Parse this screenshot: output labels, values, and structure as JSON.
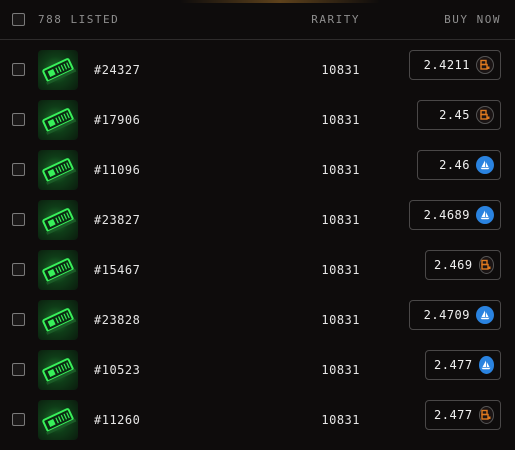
{
  "header": {
    "listed_label": "788 LISTED",
    "rarity_label": "RARITY",
    "buy_label": "BUY NOW"
  },
  "rows": [
    {
      "token": "#24327",
      "rarity": "10831",
      "price": "2.4211",
      "marketplace": "orange-b-icon"
    },
    {
      "token": "#17906",
      "rarity": "10831",
      "price": "2.45",
      "marketplace": "orange-b-icon"
    },
    {
      "token": "#11096",
      "rarity": "10831",
      "price": "2.46",
      "marketplace": "blue-sailboat-icon"
    },
    {
      "token": "#23827",
      "rarity": "10831",
      "price": "2.4689",
      "marketplace": "blue-sailboat-icon"
    },
    {
      "token": "#15467",
      "rarity": "10831",
      "price": "2.469",
      "marketplace": "orange-b-icon"
    },
    {
      "token": "#23828",
      "rarity": "10831",
      "price": "2.4709",
      "marketplace": "blue-sailboat-icon"
    },
    {
      "token": "#10523",
      "rarity": "10831",
      "price": "2.477",
      "marketplace": "blue-sailboat-icon"
    },
    {
      "token": "#11260",
      "rarity": "10831",
      "price": "2.477",
      "marketplace": "orange-b-icon"
    }
  ],
  "colors": {
    "background": "#0e0c0c",
    "orange_marketplace": "#e07a1f",
    "blue_marketplace": "#2a83e0",
    "thumb_green": "#2bd14a"
  }
}
